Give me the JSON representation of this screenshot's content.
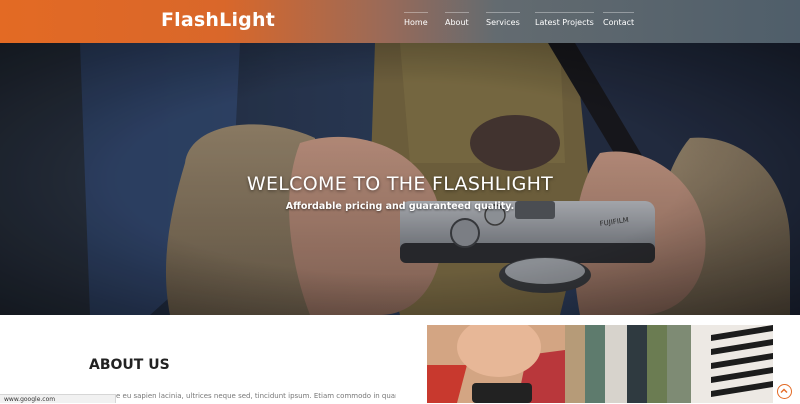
{
  "header": {
    "brand": "FlashLight",
    "nav": [
      {
        "label": "Home"
      },
      {
        "label": "About"
      },
      {
        "label": "Services"
      },
      {
        "label": "Latest Projects"
      },
      {
        "label": "Contact"
      }
    ]
  },
  "hero": {
    "title": "WELCOME TO THE FLASHLIGHT",
    "subtitle": "Affordable pricing and guaranteed quality.",
    "camera_brand_text": "FUJIFILM"
  },
  "about": {
    "heading": "ABOUT US",
    "text": "e eu sapien lacinia, ultrices neque sed, tincidunt ipsum. Etiam commodo in quam at"
  },
  "status_bar": {
    "url": "www.google.com"
  },
  "icons": {
    "scroll_top": "chevron-up-circle-icon"
  },
  "colors": {
    "accent": "#e36a24",
    "header_dark": "#4f5e6a",
    "heading": "#222222"
  }
}
